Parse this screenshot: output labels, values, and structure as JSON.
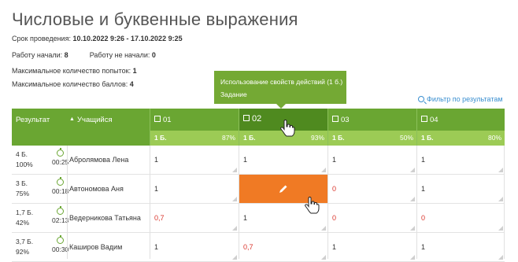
{
  "page": {
    "title": "Числовые и буквенные выражения",
    "period_label": "Срок проведения:",
    "period_value": "10.10.2022 9:26 - 17.10.2022 9:25",
    "started_label": "Работу начали:",
    "started_value": "8",
    "not_started_label": "Работу не начали:",
    "not_started_value": "0",
    "max_attempts_label": "Максимальное количество попыток:",
    "max_attempts_value": "1",
    "max_score_label": "Максимальное количество баллов:",
    "max_score_value": "4"
  },
  "tooltip": {
    "line1": "Использование свойств действий (1 б.)",
    "line2": "Задание"
  },
  "filter": {
    "label": "Фильтр по результатам",
    "icon": "search-icon"
  },
  "table": {
    "headers": {
      "result": "Результат",
      "student": "Учащийся",
      "sort_icon": "▲"
    },
    "tasks": [
      {
        "label": "01",
        "points": "1 Б.",
        "percent": "87%"
      },
      {
        "label": "02",
        "points": "1 Б.",
        "percent": "93%"
      },
      {
        "label": "03",
        "points": "1 Б.",
        "percent": "50%"
      },
      {
        "label": "04",
        "points": "1 Б.",
        "percent": "80%"
      }
    ],
    "rows": [
      {
        "score": "4 Б.",
        "percent": "100%",
        "time": "00:25",
        "student": "Абролямова Лена",
        "cells": [
          "1",
          "1",
          "1",
          "1"
        ],
        "red": [
          false,
          false,
          false,
          false
        ]
      },
      {
        "score": "3 Б.",
        "percent": "75%",
        "time": "00:18",
        "student": "Автономова Аня",
        "cells": [
          "1",
          "",
          "0",
          "1"
        ],
        "red": [
          false,
          false,
          true,
          false
        ]
      },
      {
        "score": "1,7 Б.",
        "percent": "42%",
        "time": "02:13",
        "student": "Ведерникова Татьяна",
        "cells": [
          "0,7",
          "1",
          "0",
          "0"
        ],
        "red": [
          true,
          false,
          true,
          true
        ]
      },
      {
        "score": "3,7 Б.",
        "percent": "92%",
        "time": "00:30",
        "student": "Каширов Вадим",
        "cells": [
          "1",
          "0,7",
          "1",
          "1"
        ],
        "red": [
          false,
          true,
          false,
          false
        ]
      }
    ]
  },
  "colors": {
    "header_green": "#6aa632",
    "subheader_green": "#9ccb55",
    "highlight_orange": "#f07a24",
    "error_red": "#d9342b"
  }
}
